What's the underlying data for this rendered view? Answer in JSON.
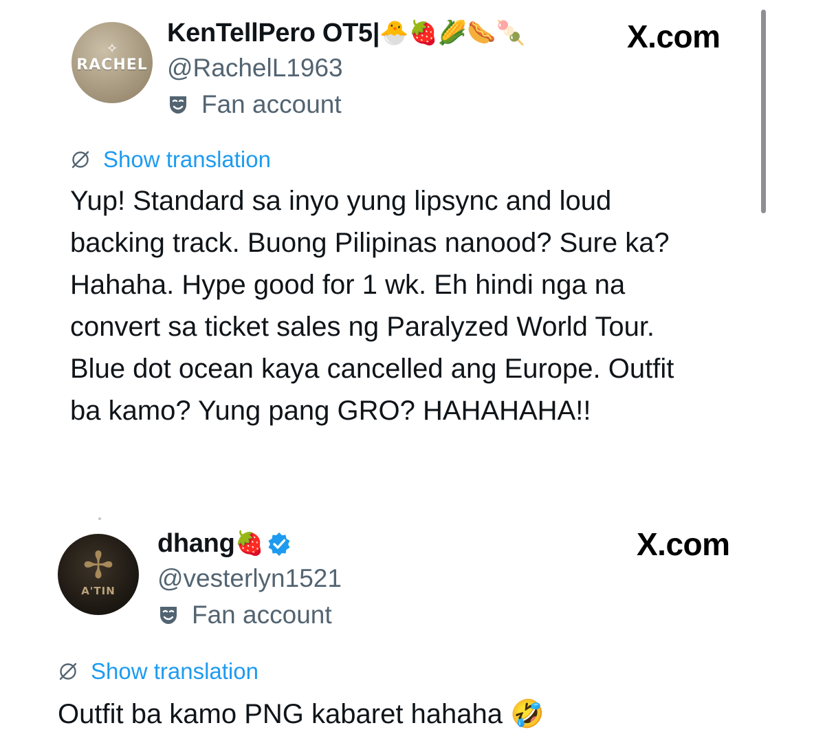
{
  "tweets": [
    {
      "avatar_text": "RACHEL",
      "display_name": "KenTellPero OT5|",
      "name_emojis": [
        "🐣",
        "🍓",
        "🌽",
        "🌭",
        "🍡"
      ],
      "handle": "@RachelL1963",
      "site_label": "X.com",
      "fan_label": "Fan account",
      "translate_label": "Show translation",
      "text": "Yup! Standard sa inyo yung lipsync and loud\nbacking track. Buong Pilipinas nanood? Sure ka?\nHahaha. Hype good for 1 wk. Eh hindi nga na\nconvert sa ticket sales ng Paralyzed World Tour.\nBlue dot ocean kaya cancelled ang Europe. Outfit\nba kamo? Yung pang GRO? HAHAHAHA!!"
    },
    {
      "avatar_text": "A'TIN",
      "display_name": "dhang",
      "name_emojis": [
        "🍓"
      ],
      "verified": true,
      "handle": "@vesterlyn1521",
      "site_label": "X.com",
      "fan_label": "Fan account",
      "translate_label": "Show translation",
      "text": "Outfit ba kamo PNG kabaret hahaha 🤣"
    }
  ],
  "colors": {
    "text_primary": "#0f1419",
    "text_secondary": "#536471",
    "link": "#1d9bf0",
    "verified": "#1d9bf0"
  },
  "icons": {
    "fan_account": "mask-icon",
    "translation": "globe-slash-icon",
    "verified": "verified-badge-icon"
  }
}
